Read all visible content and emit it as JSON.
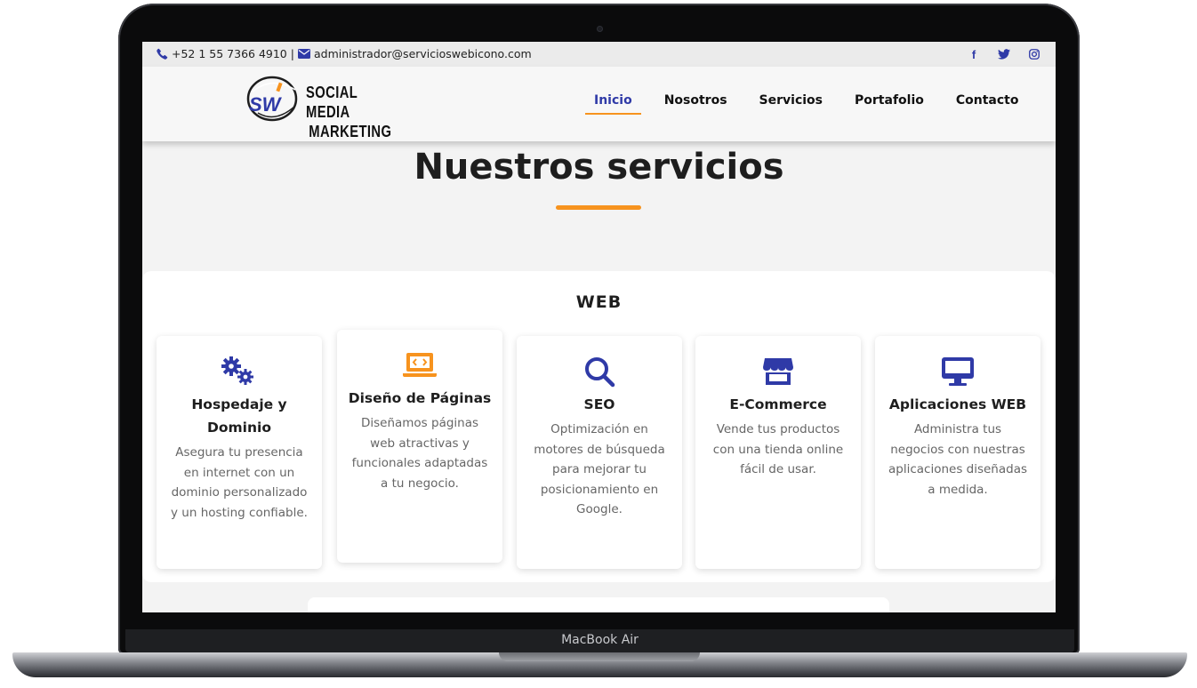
{
  "topbar": {
    "phone": "+52 1 55 7366 4910",
    "separator": "|",
    "email": "administrador@servicioswebicono.com",
    "social_icons": [
      "facebook-icon",
      "twitter-icon",
      "instagram-icon"
    ]
  },
  "logo": {
    "monogram": "SW",
    "line1": "SOCIAL MEDIA",
    "line2": "MARKETING"
  },
  "nav": {
    "items": [
      "Inicio",
      "Nosotros",
      "Servicios",
      "Portafolio",
      "Contacto"
    ],
    "active": "Inicio"
  },
  "page": {
    "title": "Nuestros servicios",
    "section": "WEB"
  },
  "services": [
    {
      "icon": "gears-icon",
      "title": "Hospedaje y Dominio",
      "desc": "Asegura tu presencia en internet con un dominio personalizado y un hosting confiable.",
      "icon_color": "#2f3aa7"
    },
    {
      "icon": "laptop-code-icon",
      "title": "Diseño de Páginas",
      "desc": "Diseñamos páginas web atractivas y funcionales adaptadas a tu negocio.",
      "icon_color": "#f7931e"
    },
    {
      "icon": "search-icon",
      "title": "SEO",
      "desc": "Optimización en motores de búsqueda para mejorar tu posicionamiento en Google.",
      "icon_color": "#2f3aa7"
    },
    {
      "icon": "store-icon",
      "title": "E-Commerce",
      "desc": "Vende tus productos con una tienda online fácil de usar.",
      "icon_color": "#2f3aa7"
    },
    {
      "icon": "desktop-icon",
      "title": "Aplicaciones WEB",
      "desc": "Administra tus negocios con nuestras aplicaciones diseñadas a medida.",
      "icon_color": "#2f3aa7"
    }
  ],
  "device": {
    "label": "MacBook Air"
  },
  "colors": {
    "primary": "#2f3aa7",
    "accent": "#f7931e",
    "text": "#1e1e1e"
  }
}
